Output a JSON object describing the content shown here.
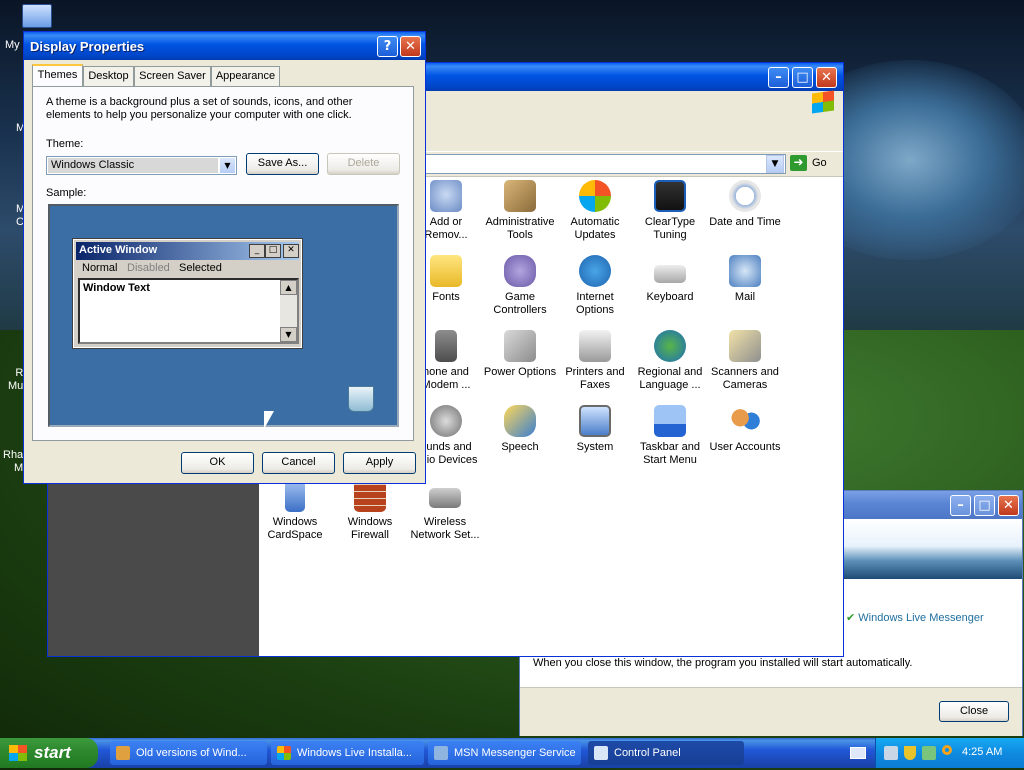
{
  "desktop": {
    "icons": [
      "My",
      "M",
      "M\nC",
      "R\nMu",
      "Rha\nM"
    ]
  },
  "display_properties": {
    "title": "Display Properties",
    "tabs": [
      "Themes",
      "Desktop",
      "Screen Saver",
      "Appearance"
    ],
    "description": "A theme is a background plus a set of sounds, icons, and other elements to help you personalize your computer with one click.",
    "theme_label": "Theme:",
    "theme_value": "Windows Classic",
    "save_as": "Save As...",
    "delete": "Delete",
    "sample_label": "Sample:",
    "sample_window": {
      "title": "Active Window",
      "menu": [
        "Normal",
        "Disabled",
        "Selected"
      ],
      "window_text": "Window Text"
    },
    "ok": "OK",
    "cancel": "Cancel",
    "apply": "Apply",
    "help_glyph": "?",
    "close_glyph": "✕"
  },
  "control_panel": {
    "go": "Go",
    "items": [
      {
        "label": "Add or\nRemov..."
      },
      {
        "label": "Administrative\nTools"
      },
      {
        "label": "Automatic\nUpdates"
      },
      {
        "label": "ClearType\nTuning"
      },
      {
        "label": "Date and Time"
      },
      {
        "label": "Fonts"
      },
      {
        "label": "Game\nControllers"
      },
      {
        "label": "Internet\nOptions"
      },
      {
        "label": "Keyboard"
      },
      {
        "label": "Mail"
      },
      {
        "label": "hone and\nModem ..."
      },
      {
        "label": "Power Options"
      },
      {
        "label": "Printers and\nFaxes"
      },
      {
        "label": "Regional and\nLanguage ..."
      },
      {
        "label": "Scanners and\nCameras"
      },
      {
        "label": "ounds and\nudio Devices"
      },
      {
        "label": "Speech"
      },
      {
        "label": "System"
      },
      {
        "label": "Taskbar and\nStart Menu"
      },
      {
        "label": "User Accounts"
      },
      {
        "label": "Windows\nCardSpace"
      },
      {
        "label": "Windows\nFirewall"
      },
      {
        "label": "Wireless\nNetwork Set..."
      }
    ]
  },
  "installer": {
    "messenger_item": "Windows Live Messenger",
    "message": "When you close this window, the program you installed will start automatically.",
    "close": "Close"
  },
  "taskbar": {
    "start": "start",
    "tasks": [
      "Old versions of Wind...",
      "Windows Live Installa...",
      "MSN Messenger Service",
      "Control Panel"
    ],
    "clock": "4:25 AM"
  }
}
